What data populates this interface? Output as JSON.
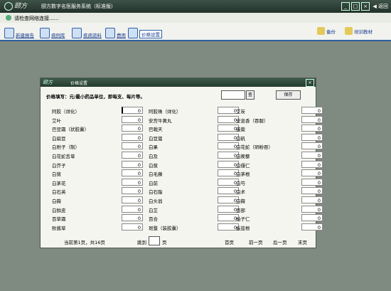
{
  "app": {
    "logo": "颐方",
    "title": "颐方数字名医服务系统（标准版）",
    "window_controls": [
      "min",
      "restore",
      "close"
    ],
    "return_label": "返回"
  },
  "status": {
    "text": "请检查网络连接......"
  },
  "toolbar": {
    "items": [
      {
        "label": "新建报告",
        "icon": "new-report-icon"
      },
      {
        "label": "病例库",
        "icon": "case-library-icon"
      },
      {
        "label": "疾病资料",
        "icon": "disease-info-icon"
      },
      {
        "label": "费用",
        "icon": "cost-icon"
      },
      {
        "label": "价格设置",
        "icon": "price-settings-icon",
        "active": true
      }
    ],
    "right_items": [
      {
        "label": "备份",
        "icon": "backup-icon"
      },
      {
        "label": "培训教材",
        "icon": "training-icon"
      }
    ]
  },
  "dialog": {
    "logo": "颐方",
    "title": "价格设置",
    "instruction": "价格填写：元/最小药品单位，即每支、每片等。",
    "search_button": "查",
    "save_button": "保存",
    "rows": [
      [
        {
          "name": "阿胶（烊化）",
          "value": "0"
        },
        {
          "name": "阿胶珠（烊化）",
          "value": "0"
        },
        {
          "name": "艾炭",
          "value": "0"
        }
      ],
      [
        {
          "name": "艾叶",
          "value": "0"
        },
        {
          "name": "安宫牛黄丸",
          "value": "0"
        },
        {
          "name": "安息香（吞服）",
          "value": "0"
        }
      ],
      [
        {
          "name": "巴豆霜（状胶囊）",
          "value": "0"
        },
        {
          "name": "巴戟天",
          "value": "0"
        },
        {
          "name": "菝葜",
          "value": "0"
        }
      ],
      [
        {
          "name": "白扁豆",
          "value": "0"
        },
        {
          "name": "白豆蔻",
          "value": "0"
        },
        {
          "name": "白矾",
          "value": "0"
        }
      ],
      [
        {
          "name": "白附子（制）",
          "value": "0"
        },
        {
          "name": "白果",
          "value": "0"
        },
        {
          "name": "白花蛇（研粉吞）",
          "value": "0"
        }
      ],
      [
        {
          "name": "白花蛇舌草",
          "value": "0"
        },
        {
          "name": "白及",
          "value": "0"
        },
        {
          "name": "白蒺藜",
          "value": "0"
        }
      ],
      [
        {
          "name": "白芥子",
          "value": "0"
        },
        {
          "name": "白蔹",
          "value": "0"
        },
        {
          "name": "白僵仁",
          "value": "0"
        }
      ],
      [
        {
          "name": "白蔹",
          "value": "0"
        },
        {
          "name": "白毛藤",
          "value": "0"
        },
        {
          "name": "白茅根",
          "value": "0"
        }
      ],
      [
        {
          "name": "白茅花",
          "value": "0"
        },
        {
          "name": "白前",
          "value": "0"
        },
        {
          "name": "白芍",
          "value": "0"
        }
      ],
      [
        {
          "name": "白石英",
          "value": "0"
        },
        {
          "name": "白石脂",
          "value": "0"
        },
        {
          "name": "白术",
          "value": "0"
        }
      ],
      [
        {
          "name": "白薇",
          "value": "0"
        },
        {
          "name": "白头翁",
          "value": "0"
        },
        {
          "name": "白薇",
          "value": "0"
        }
      ],
      [
        {
          "name": "白鲜皮",
          "value": "0"
        },
        {
          "name": "白芷",
          "value": "0"
        },
        {
          "name": "百部",
          "value": "0"
        }
      ],
      [
        {
          "name": "百草霜",
          "value": "0"
        },
        {
          "name": "百合",
          "value": "0"
        },
        {
          "name": "柏子仁",
          "value": "0"
        }
      ],
      [
        {
          "name": "败酱草",
          "value": "0"
        },
        {
          "name": "斑蝥（装胶囊）",
          "value": "0"
        },
        {
          "name": "板蓝根",
          "value": "0"
        }
      ]
    ],
    "pager": {
      "summary": "当前第1页，共16页",
      "goto_label": "跳到",
      "page_unit": "页",
      "first": "首页",
      "prev": "前一页",
      "next": "后一页",
      "last": "末页"
    }
  }
}
